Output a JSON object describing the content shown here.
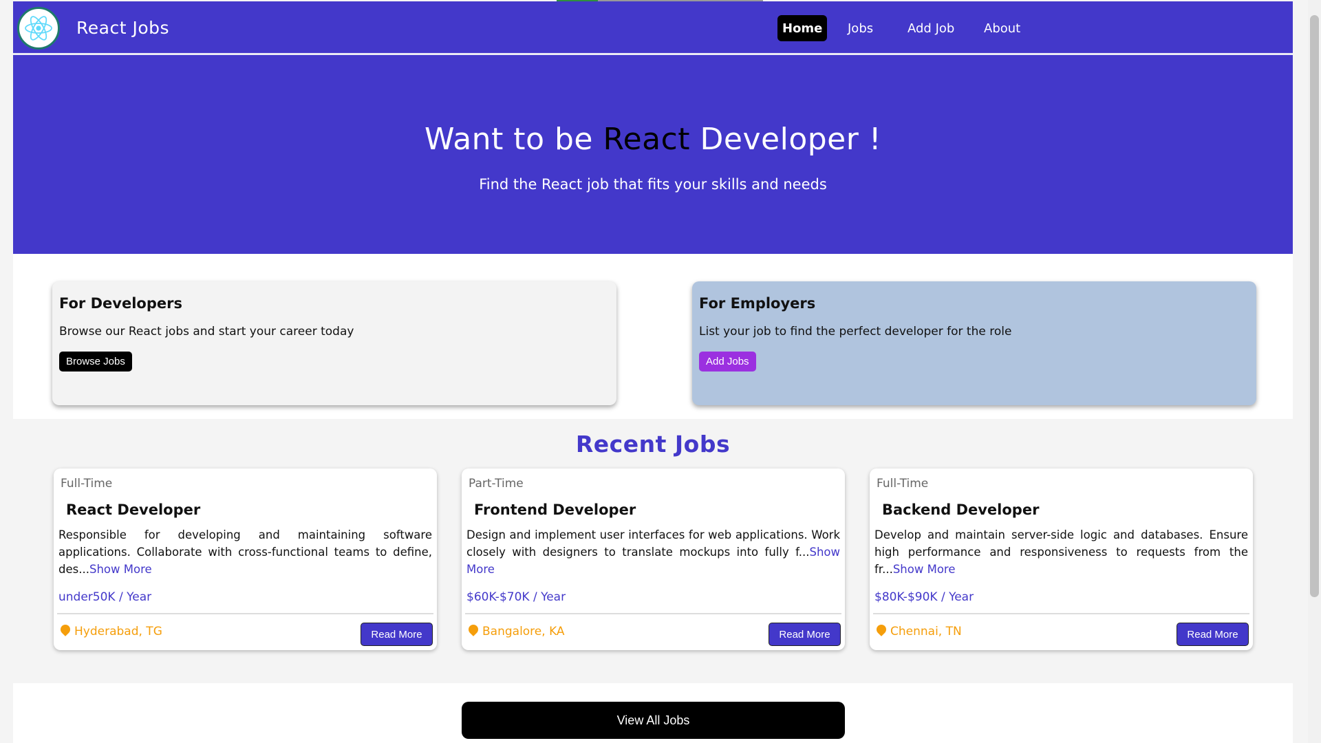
{
  "navbar": {
    "brand": "React Jobs",
    "links": [
      {
        "label": "Home",
        "active": true
      },
      {
        "label": "Jobs",
        "active": false
      },
      {
        "label": "Add Job",
        "active": false
      },
      {
        "label": "About",
        "active": false
      }
    ]
  },
  "hero": {
    "title_pre": "Want to be ",
    "title_accent": "React",
    "title_post": " Developer !",
    "subtitle": "Find the React job that fits your skills and needs"
  },
  "cards": {
    "developers": {
      "title": "For Developers",
      "text": "Browse our React jobs and start your career today",
      "button": "Browse Jobs"
    },
    "employers": {
      "title": "For Employers",
      "text": "List your job to find the perfect developer for the role",
      "button": "Add Jobs"
    }
  },
  "recent": {
    "title": "Recent Jobs",
    "jobs": [
      {
        "type": "Full-Time",
        "title": "React Developer",
        "desc": "Responsible for developing and maintaining software applications. Collaborate with cross-functional teams to define, des...",
        "show_more": "Show More",
        "salary": "under50K / Year",
        "location": "Hyderabad, TG",
        "read_more": "Read More"
      },
      {
        "type": "Part-Time",
        "title": "Frontend Developer",
        "desc": "Design and implement user interfaces for web applications. Work closely with designers to translate mockups into fully f...",
        "show_more": "Show More",
        "salary": "$60K-$70K / Year",
        "location": "Bangalore, KA",
        "read_more": "Read More"
      },
      {
        "type": "Full-Time",
        "title": "Backend Developer",
        "desc": "Develop and maintain server-side logic and databases. Ensure high performance and responsiveness to requests from the fr...",
        "show_more": "Show More",
        "salary": "$80K-$90K / Year",
        "location": "Chennai, TN",
        "read_more": "Read More"
      }
    ]
  },
  "view_all": "View All Jobs",
  "colors": {
    "primary": "#4338ca",
    "employers_card": "#b0c4de",
    "add_jobs_button": "#9b30e0",
    "location": "#f59e0b"
  }
}
